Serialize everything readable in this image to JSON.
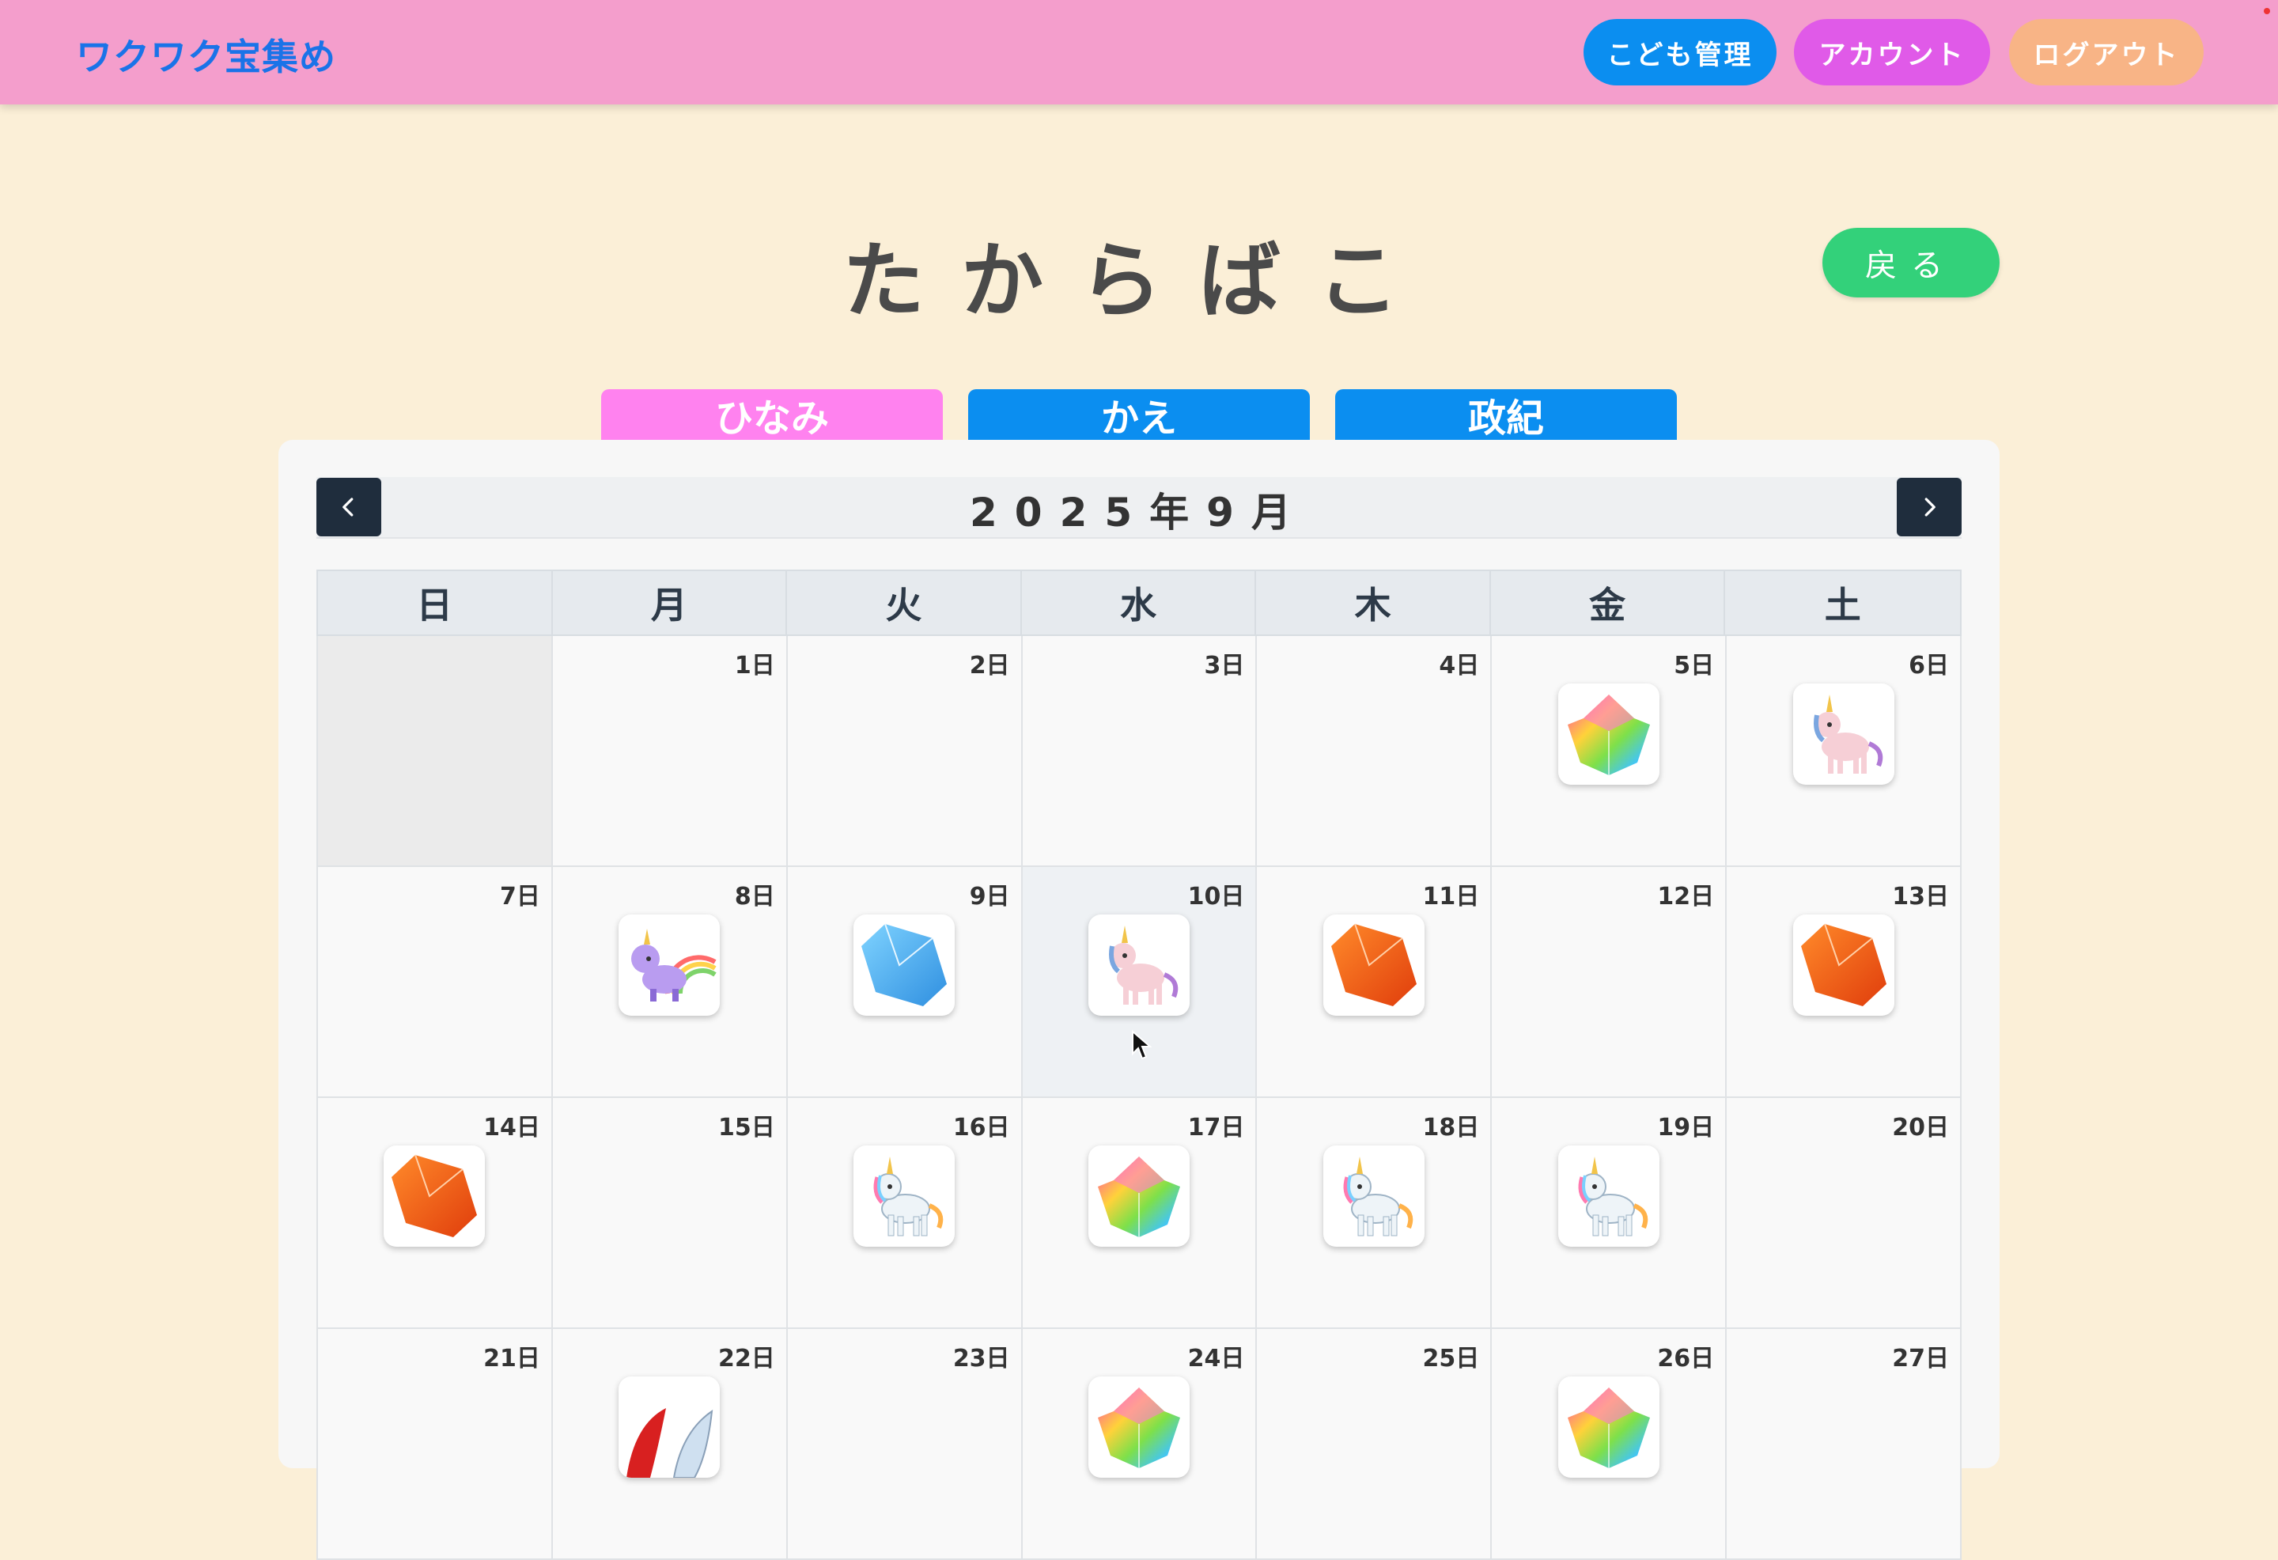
{
  "header": {
    "logo": "ワクワク宝集め",
    "buttons": {
      "kids": "こども管理",
      "account": "アカウント",
      "logout": "ログアウト"
    }
  },
  "page": {
    "title": "たからばこ",
    "back": "戻る"
  },
  "tabs": [
    "ひなみ",
    "かえ",
    "政紀"
  ],
  "calendar": {
    "month_label": "2025年9月",
    "weekdays": [
      "日",
      "月",
      "火",
      "水",
      "木",
      "金",
      "土"
    ],
    "cells": [
      {
        "day": "",
        "sticker": null,
        "empty": true
      },
      {
        "day": "1日",
        "sticker": null
      },
      {
        "day": "2日",
        "sticker": null
      },
      {
        "day": "3日",
        "sticker": null
      },
      {
        "day": "4日",
        "sticker": null
      },
      {
        "day": "5日",
        "sticker": "rainbow-gem"
      },
      {
        "day": "6日",
        "sticker": "pink-unicorn"
      },
      {
        "day": "7日",
        "sticker": null
      },
      {
        "day": "8日",
        "sticker": "purple-unicorn-rainbow"
      },
      {
        "day": "9日",
        "sticker": "blue-gem"
      },
      {
        "day": "10日",
        "sticker": "pink-unicorn",
        "today": true
      },
      {
        "day": "11日",
        "sticker": "orange-gem"
      },
      {
        "day": "12日",
        "sticker": null
      },
      {
        "day": "13日",
        "sticker": "orange-gem"
      },
      {
        "day": "14日",
        "sticker": "orange-gem"
      },
      {
        "day": "15日",
        "sticker": null
      },
      {
        "day": "16日",
        "sticker": "white-unicorn"
      },
      {
        "day": "17日",
        "sticker": "rainbow-gem"
      },
      {
        "day": "18日",
        "sticker": "white-unicorn"
      },
      {
        "day": "19日",
        "sticker": "white-unicorn"
      },
      {
        "day": "20日",
        "sticker": null
      },
      {
        "day": "21日",
        "sticker": null
      },
      {
        "day": "22日",
        "sticker": "red-feather"
      },
      {
        "day": "23日",
        "sticker": null
      },
      {
        "day": "24日",
        "sticker": "rainbow-gem"
      },
      {
        "day": "25日",
        "sticker": null
      },
      {
        "day": "26日",
        "sticker": "rainbow-gem"
      },
      {
        "day": "27日",
        "sticker": null
      }
    ]
  },
  "colors": {
    "header_bg": "#f49ecc",
    "page_bg": "#fbefd7",
    "tab_active": "#ff82ef",
    "tab_inactive": "#0b8ef0",
    "back_button": "#33d17a"
  }
}
